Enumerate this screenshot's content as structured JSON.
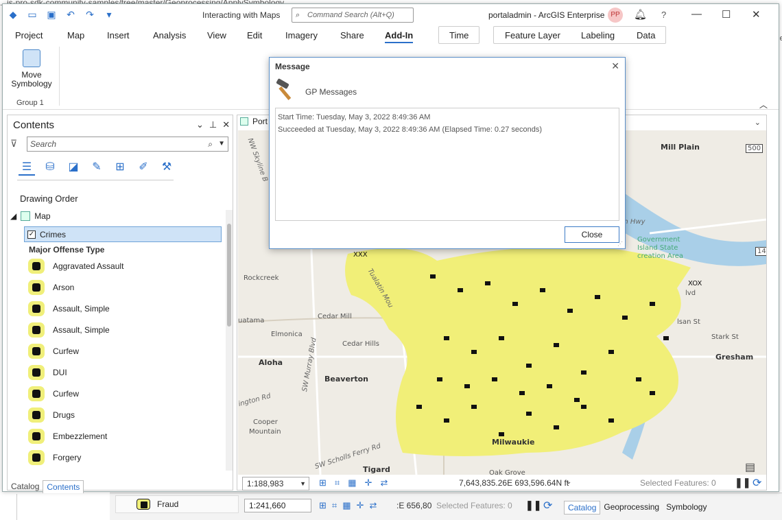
{
  "background": {
    "url_fragment": "...is-pro-sdk-community-samples/tree/master/Geoprocessing/ApplySymbology",
    "right_fragment": "[Je",
    "fraud_label": "Fraud",
    "scale": "1:241,660",
    "coords": ":E 656,80",
    "selected": "Selected Features: 0",
    "tabs": [
      "Catalog",
      "Geoprocessing",
      "Symbology"
    ]
  },
  "titlebar": {
    "title": "Interacting with Maps",
    "command_search": "Command Search (Alt+Q)",
    "user": "portaladmin - ArcGIS Enterprise",
    "avatar": "PP",
    "help": "?"
  },
  "tabs": {
    "main": [
      "Project",
      "Map",
      "Insert",
      "Analysis",
      "View",
      "Edit",
      "Imagery",
      "Share",
      "Add-In"
    ],
    "time": "Time",
    "feature_layer": [
      "Feature Layer",
      "Labeling",
      "Data"
    ]
  },
  "ribbon": {
    "button": "Move Symbology",
    "button_l1": "Move",
    "button_l2": "Symbology",
    "group": "Group 1"
  },
  "contents": {
    "title": "Contents",
    "search_placeholder": "Search",
    "drawing_order": "Drawing Order",
    "map": "Map",
    "layer": "Crimes",
    "field": "Major Offense Type",
    "items": [
      "Aggravated Assault",
      "Arson",
      "Assault, Simple",
      "Assault, Simple",
      "Curfew",
      "DUI",
      "Curfew",
      "Drugs",
      "Embezzlement",
      "Forgery"
    ],
    "tabs": [
      "Catalog",
      "Contents"
    ]
  },
  "mapview": {
    "tab": "Port",
    "scale": "1:188,983",
    "coords": "7,643,835.26E 693,596.64N ft",
    "selected": "Selected Features: 0",
    "labels": {
      "mill_plain": "Mill Plain",
      "route": "500",
      "route14": "14",
      "reen_hwy": "reen Hwy",
      "gov": "Government",
      "island": "Island State",
      "creation": "creation Area",
      "rockcreek": "Rockcreek",
      "cedar_mill": "Cedar Mill",
      "tuatama": "uatama",
      "elmonica": "Elmonica",
      "cedar_hills": "Cedar Hills",
      "aloha": "Aloha",
      "beaverton": "Beaverton",
      "cooper": "Cooper",
      "mountain": "Mountain",
      "milwaukie": "Milwaukie",
      "tigard": "Tigard",
      "oak_grove": "Oak Grove",
      "gresham": "Gresham",
      "stark": "Stark St",
      "sanst": "lsan St",
      "blvd": "lvd",
      "xox": "XOX",
      "murray": "SW Murray Blvd",
      "scholls": "SW Scholls Ferry Rd",
      "ington": "ington Rd",
      "tualatin": "Tualatin Mou",
      "skyline": "NW Skyline B",
      "xxx": "XXX"
    }
  },
  "dialog": {
    "title": "Message",
    "subtitle": "GP Messages",
    "line1": "Start Time: Tuesday, May 3, 2022 8:49:36 AM",
    "line2": "Succeeded at Tuesday, May 3, 2022 8:49:36 AM (Elapsed Time: 0.27 seconds)",
    "close": "Close"
  },
  "colors": {
    "accent": "#2a6fc9",
    "highlight": "#f0ef7a",
    "selected_row": "#cfe3f7",
    "avatar_bg": "#f6c6c6"
  }
}
